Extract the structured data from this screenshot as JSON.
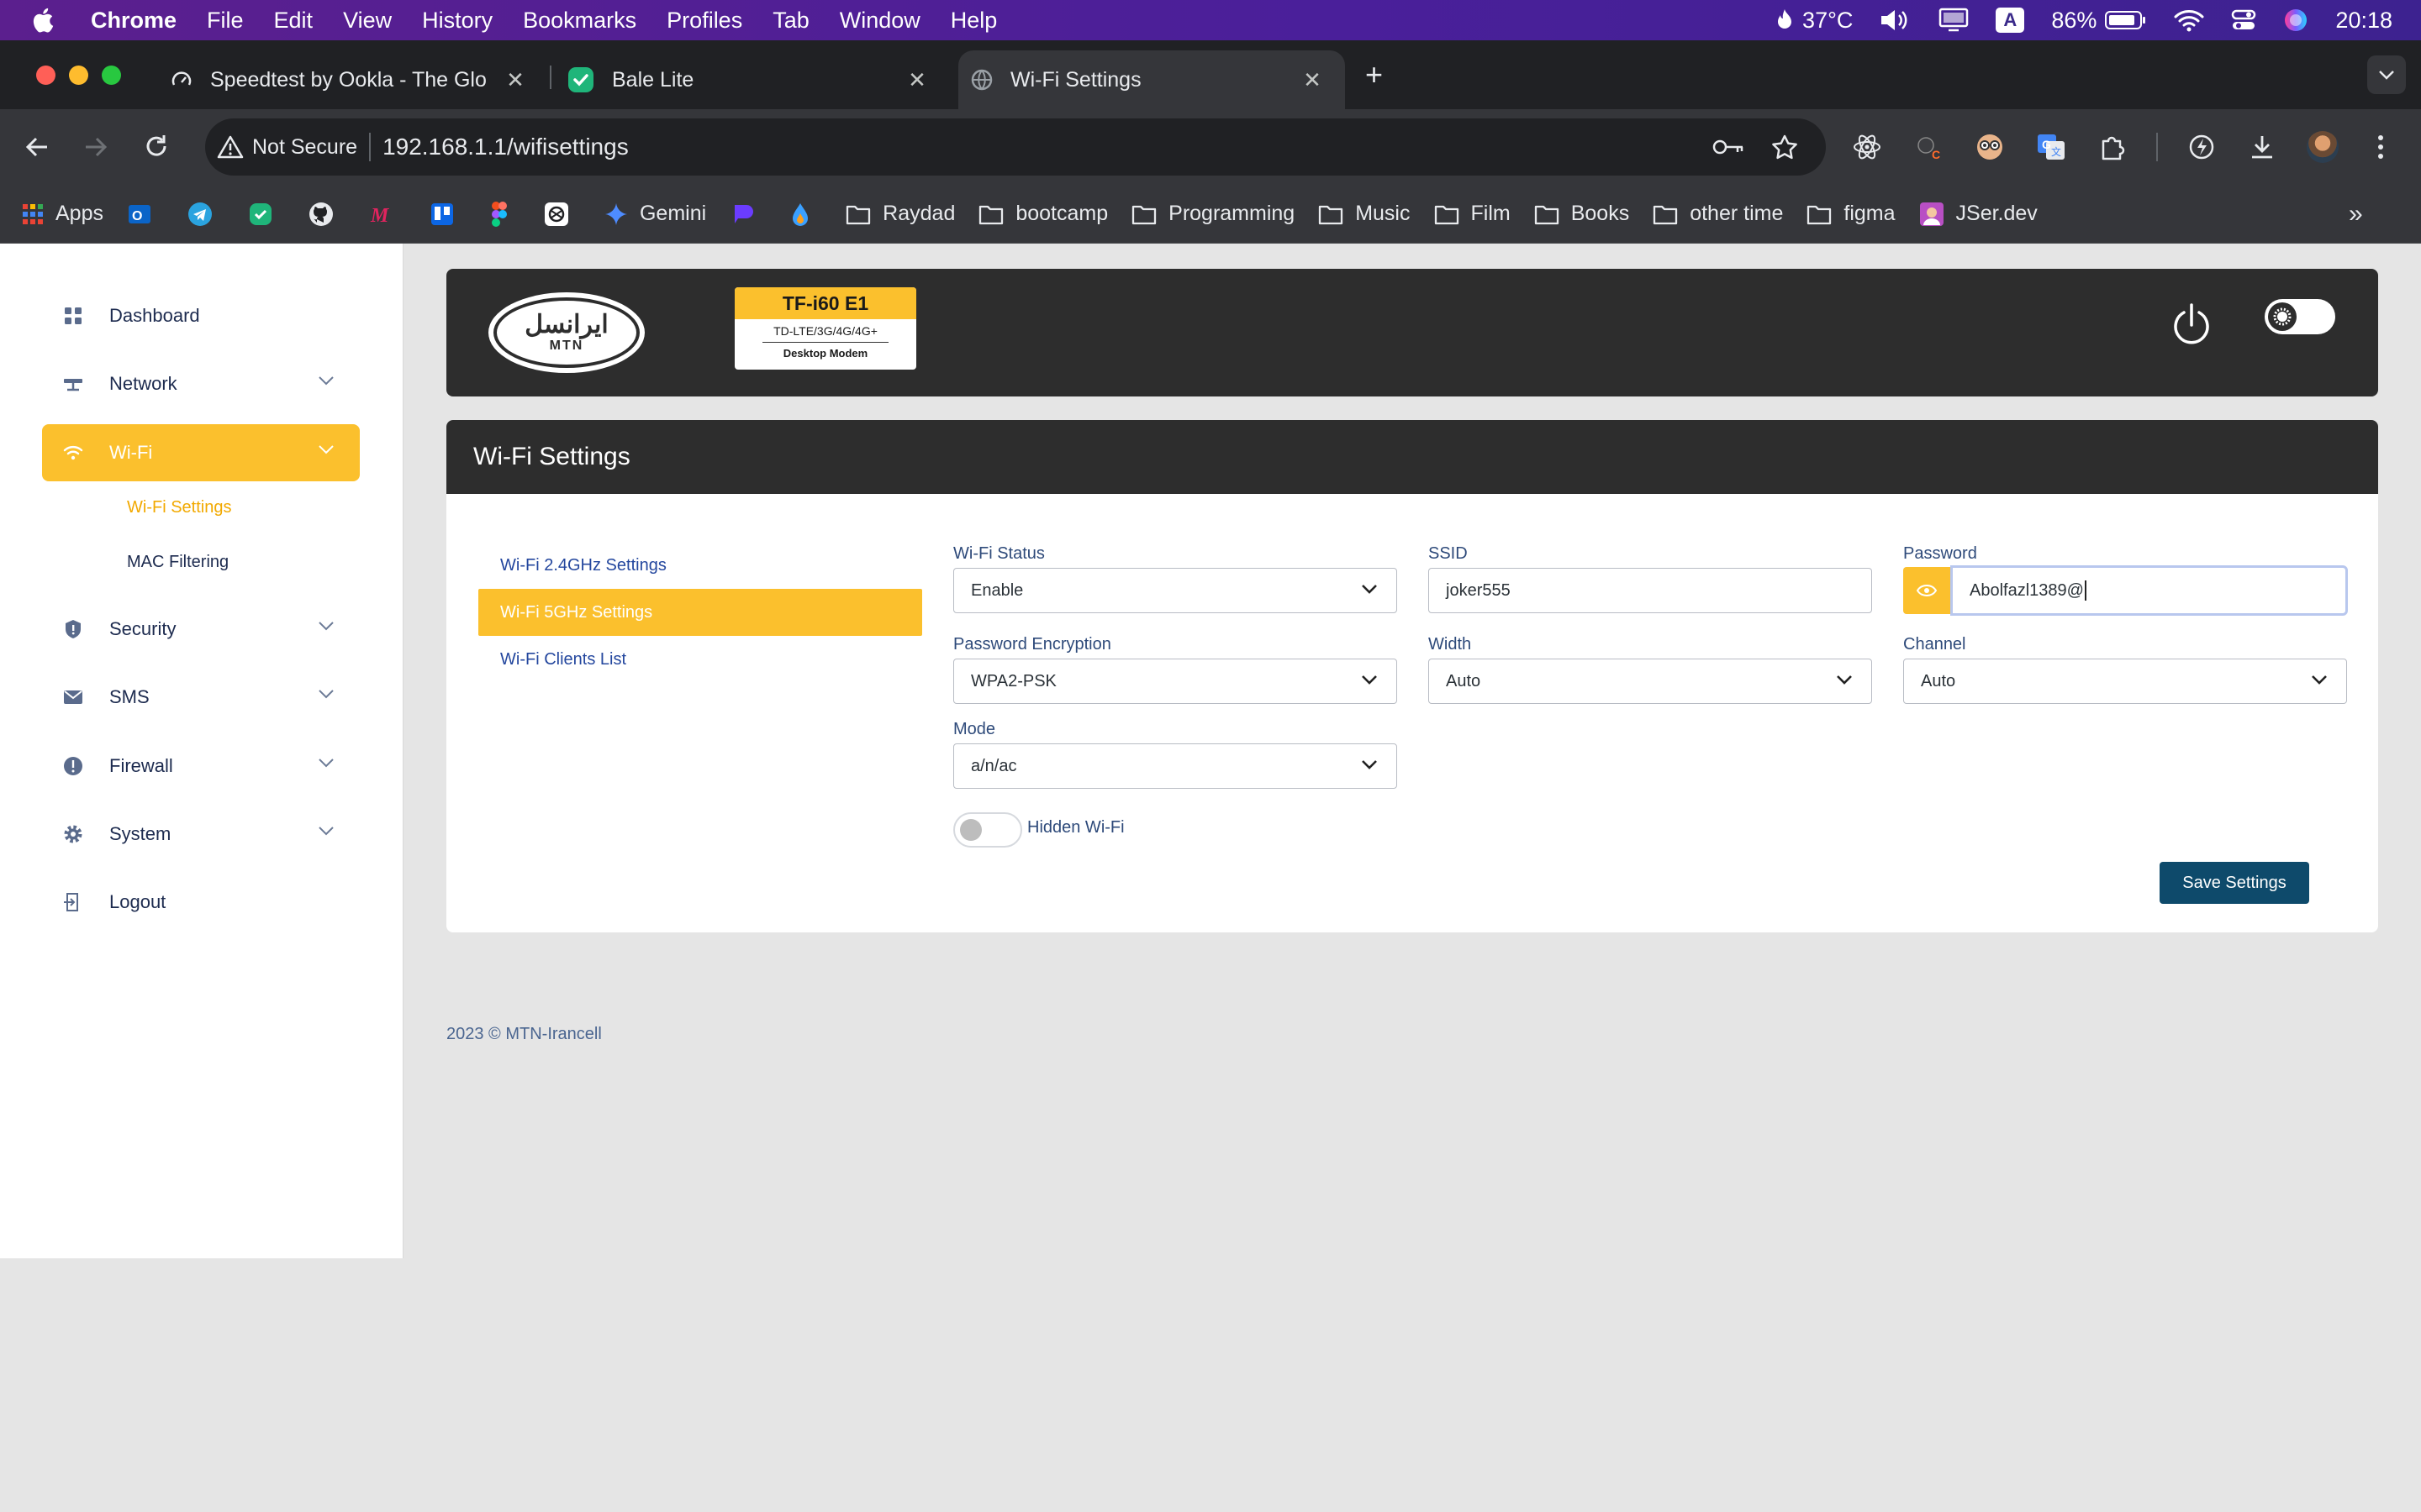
{
  "menubar": {
    "app_name": "Chrome",
    "items": [
      "File",
      "Edit",
      "View",
      "History",
      "Bookmarks",
      "Profiles",
      "Tab",
      "Window",
      "Help"
    ],
    "temperature": "37°C",
    "battery": "86%",
    "keyboard_input": "A",
    "time": "20:18"
  },
  "tabs": [
    {
      "title": "Speedtest by Ookla - The Glo",
      "active": false
    },
    {
      "title": "Bale Lite",
      "active": false
    },
    {
      "title": "Wi-Fi Settings",
      "active": true
    }
  ],
  "toolbar": {
    "security_label": "Not Secure",
    "url": "192.168.1.1/wifisettings"
  },
  "bookmarks": [
    {
      "label": "Apps",
      "icon": "apps-grid-icon"
    },
    {
      "label": "",
      "icon": "outlook-icon"
    },
    {
      "label": "",
      "icon": "telegram-icon"
    },
    {
      "label": "",
      "icon": "check-shield-icon"
    },
    {
      "label": "",
      "icon": "github-icon"
    },
    {
      "label": "",
      "icon": "m-logo-icon"
    },
    {
      "label": "",
      "icon": "trello-icon"
    },
    {
      "label": "",
      "icon": "figma-icon"
    },
    {
      "label": "",
      "icon": "chatgpt-icon"
    },
    {
      "label": "Gemini",
      "icon": "gemini-icon"
    },
    {
      "label": "",
      "icon": "purple-logo-icon"
    },
    {
      "label": "",
      "icon": "drop-logo-icon"
    },
    {
      "label": "Raydad",
      "icon": "folder-icon"
    },
    {
      "label": "bootcamp",
      "icon": "folder-icon"
    },
    {
      "label": "Programming",
      "icon": "folder-icon"
    },
    {
      "label": "Music",
      "icon": "folder-icon"
    },
    {
      "label": "Film",
      "icon": "folder-icon"
    },
    {
      "label": "Books",
      "icon": "folder-icon"
    },
    {
      "label": "other time",
      "icon": "folder-icon"
    },
    {
      "label": "figma",
      "icon": "folder-icon"
    },
    {
      "label": "JSer.dev",
      "icon": "jser-icon"
    }
  ],
  "sidebar": {
    "items": [
      {
        "label": "Dashboard"
      },
      {
        "label": "Network"
      },
      {
        "label": "Wi-Fi"
      },
      {
        "label": "Security"
      },
      {
        "label": "SMS"
      },
      {
        "label": "Firewall"
      },
      {
        "label": "System"
      },
      {
        "label": "Logout"
      }
    ],
    "subitems": [
      {
        "label": "Wi-Fi Settings"
      },
      {
        "label": "MAC Filtering"
      }
    ]
  },
  "header": {
    "logo_text": "ایرانسل",
    "logo_subtext": "MTN",
    "modem_model": "TF-i60 E1",
    "modem_bands": "TD-LTE/3G/4G/4G+",
    "modem_type": "Desktop Modem"
  },
  "wifi": {
    "title": "Wi-Fi Settings",
    "tabs": [
      "Wi-Fi 2.4GHz Settings",
      "Wi-Fi 5GHz Settings",
      "Wi-Fi Clients List"
    ],
    "fields": {
      "status": {
        "label": "Wi-Fi Status",
        "value": "Enable"
      },
      "ssid": {
        "label": "SSID",
        "value": "joker555"
      },
      "password": {
        "label": "Password",
        "value": "Abolfazl1389@"
      },
      "encryption": {
        "label": "Password Encryption",
        "value": "WPA2-PSK"
      },
      "width": {
        "label": "Width",
        "value": "Auto"
      },
      "channel": {
        "label": "Channel",
        "value": "Auto"
      },
      "mode": {
        "label": "Mode",
        "value": "a/n/ac"
      }
    },
    "hidden_label": "Hidden Wi-Fi",
    "save_label": "Save Settings"
  },
  "footer": {
    "text": "2023 © MTN-Irancell"
  },
  "colors": {
    "accent": "#fbc02d",
    "header_bg": "#2d2d2d",
    "primary_button": "#0e4a6b",
    "nav_text": "#1d2b4f"
  }
}
